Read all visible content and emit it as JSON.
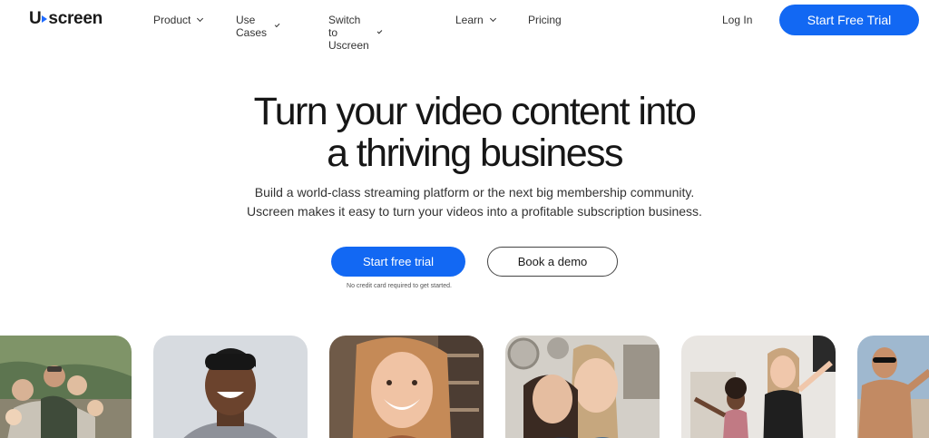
{
  "brand": {
    "logo_prefix": "U",
    "logo_suffix": "screen",
    "accent_color": "#1268f3"
  },
  "nav": {
    "items": [
      {
        "label": "Product",
        "has_dropdown": true
      },
      {
        "label": "Use Cases",
        "has_dropdown": true
      },
      {
        "label": "Switch to Uscreen",
        "has_dropdown": true
      },
      {
        "label": "Learn",
        "has_dropdown": true
      },
      {
        "label": "Pricing",
        "has_dropdown": false
      }
    ],
    "login_label": "Log In",
    "cta_label": "Start Free Trial"
  },
  "hero": {
    "headline_line1": "Turn your video content into",
    "headline_line2": "a thriving business",
    "sub_line1": "Build a world-class streaming platform or the next big membership community.",
    "sub_line2": "Uscreen makes it easy to turn your videos into a profitable subscription business.",
    "primary_button": "Start free trial",
    "secondary_button": "Book a demo",
    "note": "No credit card required to get started."
  },
  "gallery": {
    "photos": [
      {
        "icon": "family-photo"
      },
      {
        "icon": "smiling-man-photo"
      },
      {
        "icon": "smiling-woman-photo"
      },
      {
        "icon": "two-women-kitchen-photo"
      },
      {
        "icon": "fitness-class-photo"
      },
      {
        "icon": "fitness-man-photo"
      }
    ]
  }
}
